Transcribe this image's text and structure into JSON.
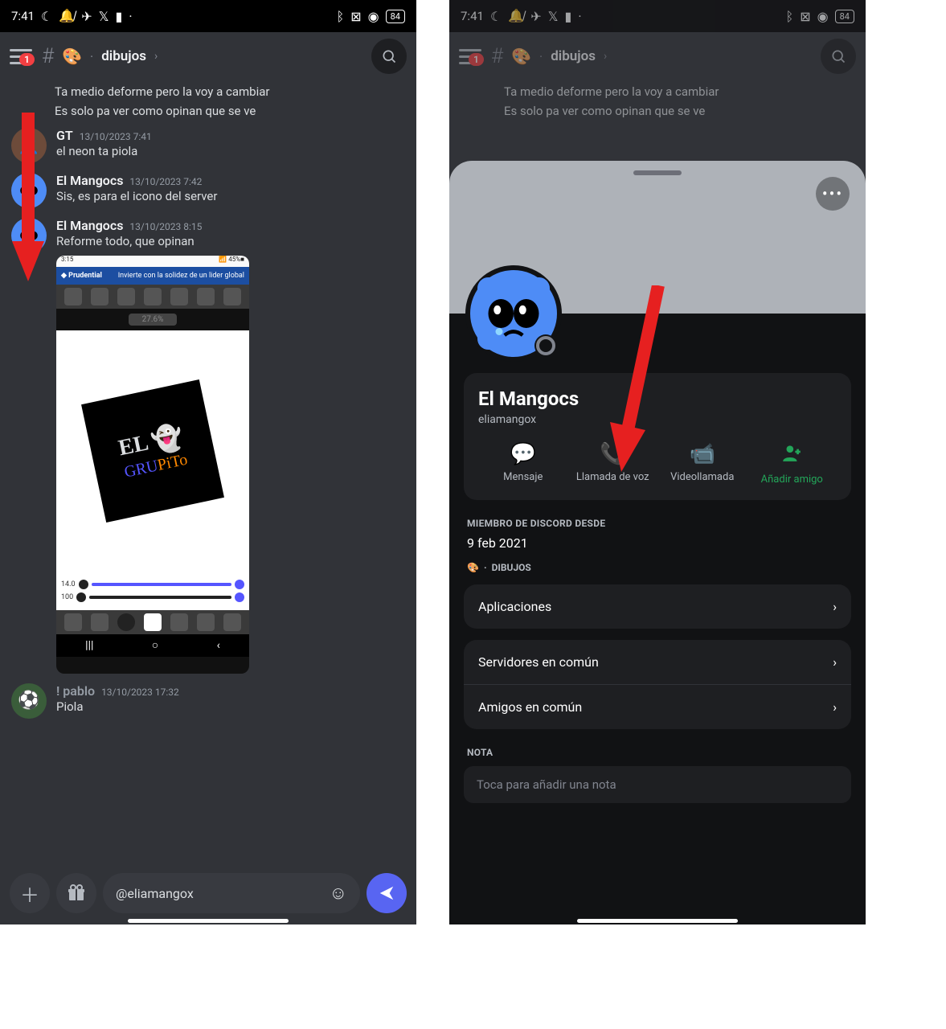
{
  "status": {
    "time": "7:41",
    "battery": "84"
  },
  "channel": {
    "emoji": "🎨",
    "name": "dibujos",
    "hamburger_badge": "1"
  },
  "messages": {
    "cont1": "Ta medio deforme pero la voy a cambiar",
    "cont2": "Es solo pa ver como opinan que se ve",
    "gt": {
      "author": "GT",
      "time": "13/10/2023 7:41",
      "text": "el neon ta piola"
    },
    "m1": {
      "author": "El Mangocs",
      "time": "13/10/2023 7:42",
      "text": "Sis, es para el icono del server"
    },
    "m2": {
      "author": "El Mangocs",
      "time": "13/10/2023 8:15",
      "text": "Reforme todo, que opinan"
    },
    "pablo": {
      "author": "! pablo",
      "time": "13/10/2023 17:32",
      "text": "Piola"
    }
  },
  "attachment": {
    "time": "3:15",
    "battery": "45%",
    "bank": "Prudential",
    "bank_tag": "Invierte con la solidez de un lider global",
    "percent": "27.6%",
    "art_line1": "EL",
    "art_line2a": "GRU",
    "art_line2b": "PiTo",
    "slider1": "14.0",
    "slider2": "100"
  },
  "input": {
    "text": "@eliamangox"
  },
  "profile": {
    "display_name": "El Mangocs",
    "username": "eliamangox",
    "actions": {
      "message": "Mensaje",
      "voice": "Llamada de voz",
      "video": "Videollamada",
      "add": "Añadir amigo"
    },
    "member_since_label": "MIEMBRO DE DISCORD DESDE",
    "member_since": "9 feb 2021",
    "server_origin": "DIBUJOS",
    "list": {
      "apps": "Aplicaciones",
      "servers": "Servidores en común",
      "friends": "Amigos en común"
    },
    "note_label": "NOTA",
    "note_placeholder": "Toca para añadir una nota"
  }
}
